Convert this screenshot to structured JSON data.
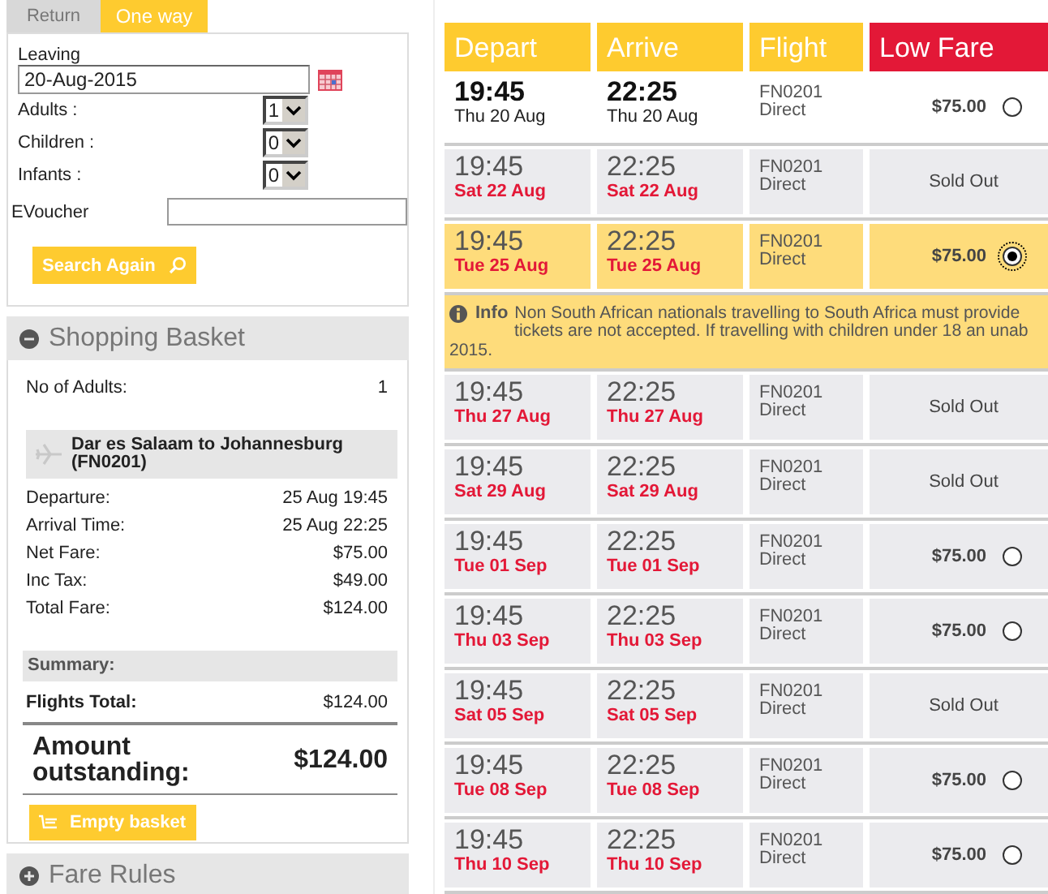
{
  "trip_tabs": [
    {
      "label": "Return",
      "selected": false
    },
    {
      "label": "One way",
      "selected": true
    }
  ],
  "search_form": {
    "leaving_label": "Leaving",
    "leaving_value": "20-Aug-2015",
    "passengers": [
      {
        "label": "Adults :",
        "value": "1"
      },
      {
        "label": "Children :",
        "value": "0"
      },
      {
        "label": "Infants :",
        "value": "0"
      }
    ],
    "evoucher_label": "EVoucher",
    "search_button": "Search Again"
  },
  "shopping_basket": {
    "title": "Shopping Basket",
    "expanded": true,
    "adults_label": "No of Adults:",
    "adults_value": "1",
    "route": "Dar es Salaam to Johannesburg (FN0201)",
    "details": [
      {
        "label": "Departure:",
        "value": "25 Aug 19:45"
      },
      {
        "label": "Arrival Time:",
        "value": "25 Aug 22:25"
      },
      {
        "label": "Net Fare:",
        "value": "$75.00"
      },
      {
        "label": "Inc Tax:",
        "value": "$49.00"
      },
      {
        "label": "Total Fare:",
        "value": "$124.00"
      }
    ],
    "summary_label": "Summary:",
    "flights_total_label": "Flights Total:",
    "flights_total_value": "$124.00",
    "amount_label": "Amount outstanding:",
    "amount_value": "$124.00",
    "empty_button": "Empty basket"
  },
  "fare_rules": {
    "title": "Fare Rules",
    "expanded": false
  },
  "flights": {
    "columns": [
      "Depart",
      "Arrive",
      "Flight",
      "Low Fare"
    ],
    "rows": [
      {
        "depart_time": "19:45",
        "depart_date": "Thu 20 Aug",
        "arrive_time": "22:25",
        "arrive_date": "Thu 20 Aug",
        "flight": "FN0201",
        "stops": "Direct",
        "kind": "available",
        "fare": "$75.00",
        "searched_date": true,
        "selected": false
      },
      {
        "depart_time": "19:45",
        "depart_date": "Sat 22 Aug",
        "arrive_time": "22:25",
        "arrive_date": "Sat 22 Aug",
        "flight": "FN0201",
        "stops": "Direct",
        "kind": "sold_out",
        "fare": "Sold Out",
        "searched_date": false
      },
      {
        "depart_time": "19:45",
        "depart_date": "Tue 25 Aug",
        "arrive_time": "22:25",
        "arrive_date": "Tue 25 Aug",
        "flight": "FN0201",
        "stops": "Direct",
        "kind": "available",
        "fare": "$75.00",
        "searched_date": false,
        "selected": true
      },
      {
        "kind": "info",
        "label": "Info",
        "lines": [
          "Non South African nationals travelling to South Africa must provide",
          "tickets are not accepted. If travelling with children under 18 an unab",
          "2015."
        ]
      },
      {
        "depart_time": "19:45",
        "depart_date": "Thu 27 Aug",
        "arrive_time": "22:25",
        "arrive_date": "Thu 27 Aug",
        "flight": "FN0201",
        "stops": "Direct",
        "kind": "sold_out",
        "fare": "Sold Out",
        "searched_date": false
      },
      {
        "depart_time": "19:45",
        "depart_date": "Sat 29 Aug",
        "arrive_time": "22:25",
        "arrive_date": "Sat 29 Aug",
        "flight": "FN0201",
        "stops": "Direct",
        "kind": "sold_out",
        "fare": "Sold Out",
        "searched_date": false
      },
      {
        "depart_time": "19:45",
        "depart_date": "Tue 01 Sep",
        "arrive_time": "22:25",
        "arrive_date": "Tue 01 Sep",
        "flight": "FN0201",
        "stops": "Direct",
        "kind": "available",
        "fare": "$75.00",
        "searched_date": false,
        "selected": false
      },
      {
        "depart_time": "19:45",
        "depart_date": "Thu 03 Sep",
        "arrive_time": "22:25",
        "arrive_date": "Thu 03 Sep",
        "flight": "FN0201",
        "stops": "Direct",
        "kind": "available",
        "fare": "$75.00",
        "searched_date": false,
        "selected": false
      },
      {
        "depart_time": "19:45",
        "depart_date": "Sat 05 Sep",
        "arrive_time": "22:25",
        "arrive_date": "Sat 05 Sep",
        "flight": "FN0201",
        "stops": "Direct",
        "kind": "sold_out",
        "fare": "Sold Out",
        "searched_date": false
      },
      {
        "depart_time": "19:45",
        "depart_date": "Tue 08 Sep",
        "arrive_time": "22:25",
        "arrive_date": "Tue 08 Sep",
        "flight": "FN0201",
        "stops": "Direct",
        "kind": "available",
        "fare": "$75.00",
        "searched_date": false,
        "selected": false
      },
      {
        "depart_time": "19:45",
        "depart_date": "Thu 10 Sep",
        "arrive_time": "22:25",
        "arrive_date": "Thu 10 Sep",
        "flight": "FN0201",
        "stops": "Direct",
        "kind": "available",
        "fare": "$75.00",
        "searched_date": false,
        "selected": false
      }
    ]
  }
}
